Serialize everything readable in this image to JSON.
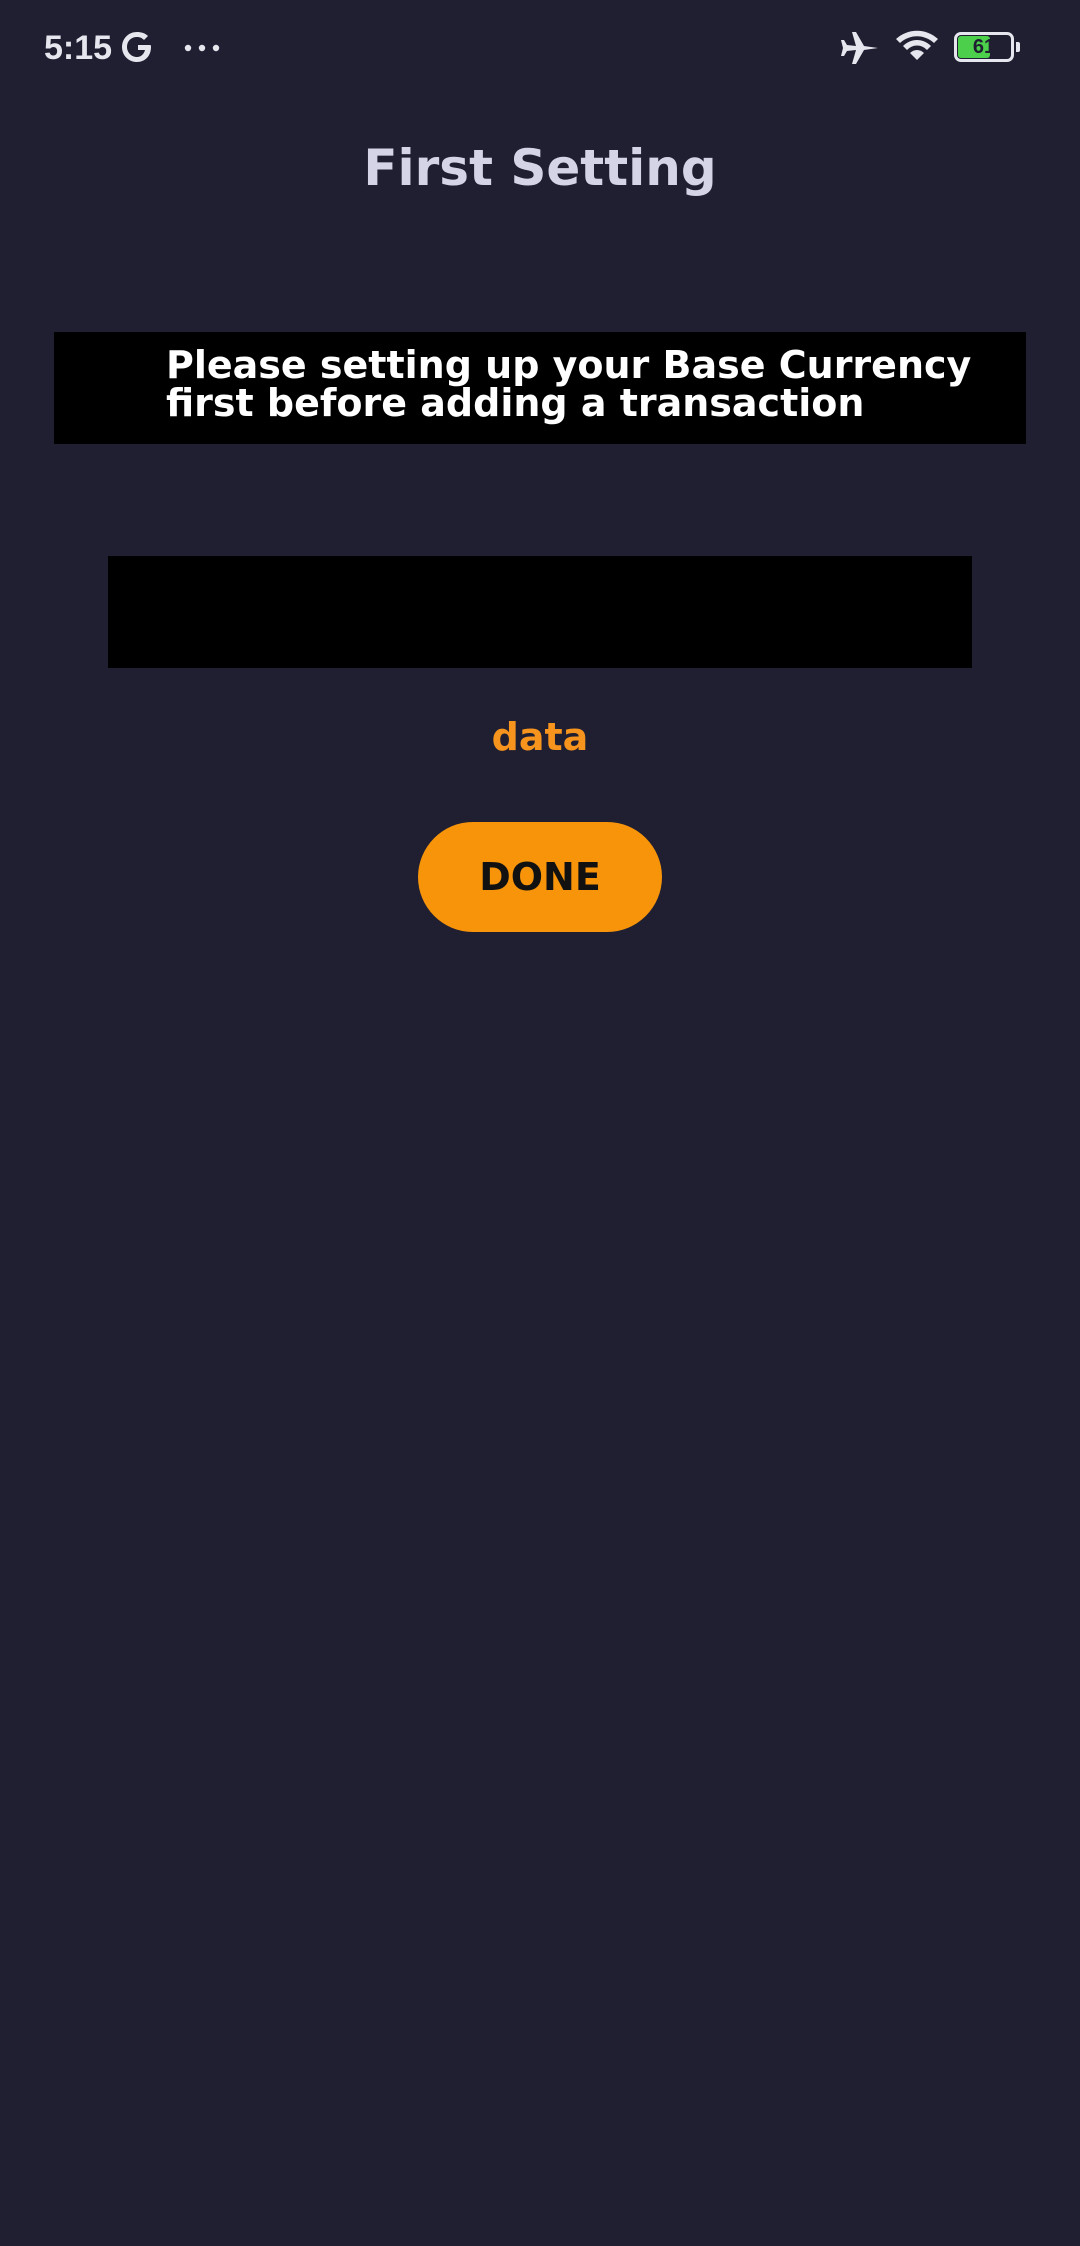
{
  "status_bar": {
    "time": "5:15",
    "battery_level": "61",
    "battery_fraction": 0.61,
    "icons": [
      "google-g-icon",
      "more-dots-icon",
      "airplane-mode-icon",
      "wifi-icon",
      "battery-icon"
    ]
  },
  "header": {
    "title": "First Setting"
  },
  "notice": {
    "text": "Please setting up your Base Currency first before adding a transaction"
  },
  "currency_field": {
    "value": ""
  },
  "data_label": "data",
  "done_button": {
    "label": "DONE"
  },
  "colors": {
    "background": "#1f1f31",
    "accent": "#f7940a",
    "panel": "#000000",
    "title": "#d4d4e6"
  }
}
